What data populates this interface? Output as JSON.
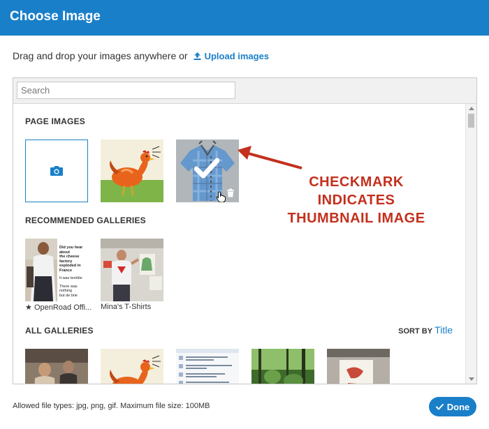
{
  "dialog": {
    "title": "Choose Image"
  },
  "upload": {
    "prompt": "Drag and drop your images anywhere or",
    "link_label": "Upload images"
  },
  "search": {
    "placeholder": "Search"
  },
  "sections": {
    "page_images": "PAGE IMAGES",
    "recommended": "RECOMMENDED GALLERIES",
    "all": "ALL GALLERIES"
  },
  "sort": {
    "label": "SORT BY",
    "value": "Title"
  },
  "recommended_galleries": [
    {
      "caption": "OpenRoad Offi...",
      "starred": true
    },
    {
      "caption": "Mina's T-Shirts",
      "starred": false
    }
  ],
  "icons": {
    "upload": "upload-icon",
    "camera": "camera-icon",
    "checkmark": "checkmark-icon",
    "trash": "trash-icon",
    "cursor": "hand-cursor-icon",
    "star": "star-icon"
  },
  "annotation": {
    "lines": [
      "CHECKMARK",
      "INDICATES",
      "THUMBNAIL IMAGE"
    ]
  },
  "footer": {
    "note": "Allowed file types: jpg, png, gif. Maximum file size: 100MB",
    "done_label": "Done"
  },
  "thumbnail_text": {
    "line1": "Did you hear about",
    "line2": "the cheese factory",
    "line3": "exploded in France",
    "line4": "It was terrible",
    "line5": "There was nothing",
    "line6": "but de brie"
  },
  "colors": {
    "brand": "#1a7fc9",
    "annotation": "#c3301e"
  }
}
